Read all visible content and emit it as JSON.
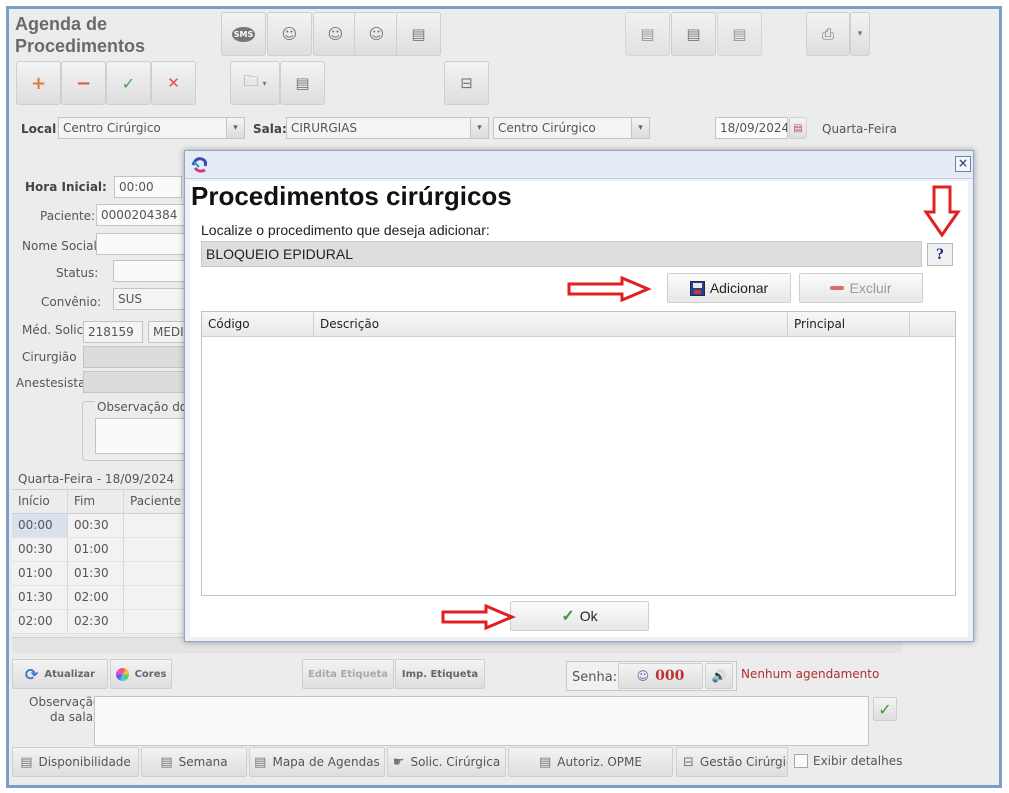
{
  "app": {
    "title_line1": "Agenda de",
    "title_line2": "Procedimentos"
  },
  "toolbar": {
    "add_icon": "plus-icon",
    "remove_icon": "minus-icon",
    "confirm_icon": "check-icon",
    "cancel_icon": "x-icon",
    "glyph_plus": "+",
    "glyph_minus": "−",
    "glyph_check": "✓",
    "glyph_x": "✕",
    "glyph_sms": "SMS",
    "glyph_person": "☺",
    "glyph_folder": "🗀",
    "glyph_dd": "▾",
    "glyph_doc": "▤",
    "glyph_print": "⎙",
    "glyph_link": "⊟"
  },
  "filters": {
    "local_label": "Local",
    "local_value": "Centro Cirúrgico",
    "sala_label": "Sala:",
    "sala_value": "CIRURGIAS",
    "third_value": "Centro Cirúrgico",
    "date_value": "18/09/2024",
    "weekday": "Quarta-Feira"
  },
  "form": {
    "hora_inicial_label": "Hora Inicial:",
    "hora_inicial_value": "00:00",
    "paciente_label": "Paciente:",
    "paciente_value": "0000204384",
    "nome_social_label": "Nome Social:",
    "status_label": "Status:",
    "convenio_label": "Convênio:",
    "convenio_value": "SUS",
    "med_solic_label": "Méd. Solic.",
    "med_solic_code": "218159",
    "med_solic_name": "MEDI",
    "cirurgiao_label": "Cirurgião",
    "anestesista_label": "Anestesista",
    "observacao_label": "Observação do"
  },
  "schedule": {
    "date_header": "Quarta-Feira - 18/09/2024",
    "columns": [
      "Início",
      "Fim",
      "Paciente"
    ],
    "rows": [
      {
        "inicio": "00:00",
        "fim": "00:30"
      },
      {
        "inicio": "00:30",
        "fim": "01:00"
      },
      {
        "inicio": "01:00",
        "fim": "01:30"
      },
      {
        "inicio": "01:30",
        "fim": "02:00"
      },
      {
        "inicio": "02:00",
        "fim": "02:30"
      }
    ]
  },
  "bottom": {
    "atualizar": "Atualizar",
    "cores": "Cores",
    "edita_etiqueta": "Edita Etiqueta",
    "imp_etiqueta": "Imp. Etiqueta",
    "senha_label": "Senha:",
    "senha_value": "000",
    "nenhum_agendamento": "Nenhum agendamento",
    "observacao_sala_line1": "Observação",
    "observacao_sala_line2": "da sala:",
    "disponibilidade": "Disponibilidade",
    "semana": "Semana",
    "mapa_agendas": "Mapa de Agendas",
    "solic_cirurgica": "Solic. Cirúrgica",
    "autoriz_opme": "Autoriz. OPME",
    "gestao_cirurgic": "Gestão Cirúrgic",
    "exibir_detalhes": "Exibir detalhes"
  },
  "modal": {
    "title": "Procedimentos cirúrgicos",
    "prompt": "Localize o procedimento que deseja adicionar:",
    "search_value": "BLOQUEIO EPIDURAL",
    "help": "?",
    "close": "×",
    "adicionar": "Adicionar",
    "excluir": "Excluir",
    "columns": [
      "Código",
      "Descrição",
      "Principal"
    ],
    "ok": "Ok"
  },
  "colors": {
    "arrow_red": "#e02020",
    "frame_blue": "#7f9cc9",
    "status_red": "#b03030"
  }
}
